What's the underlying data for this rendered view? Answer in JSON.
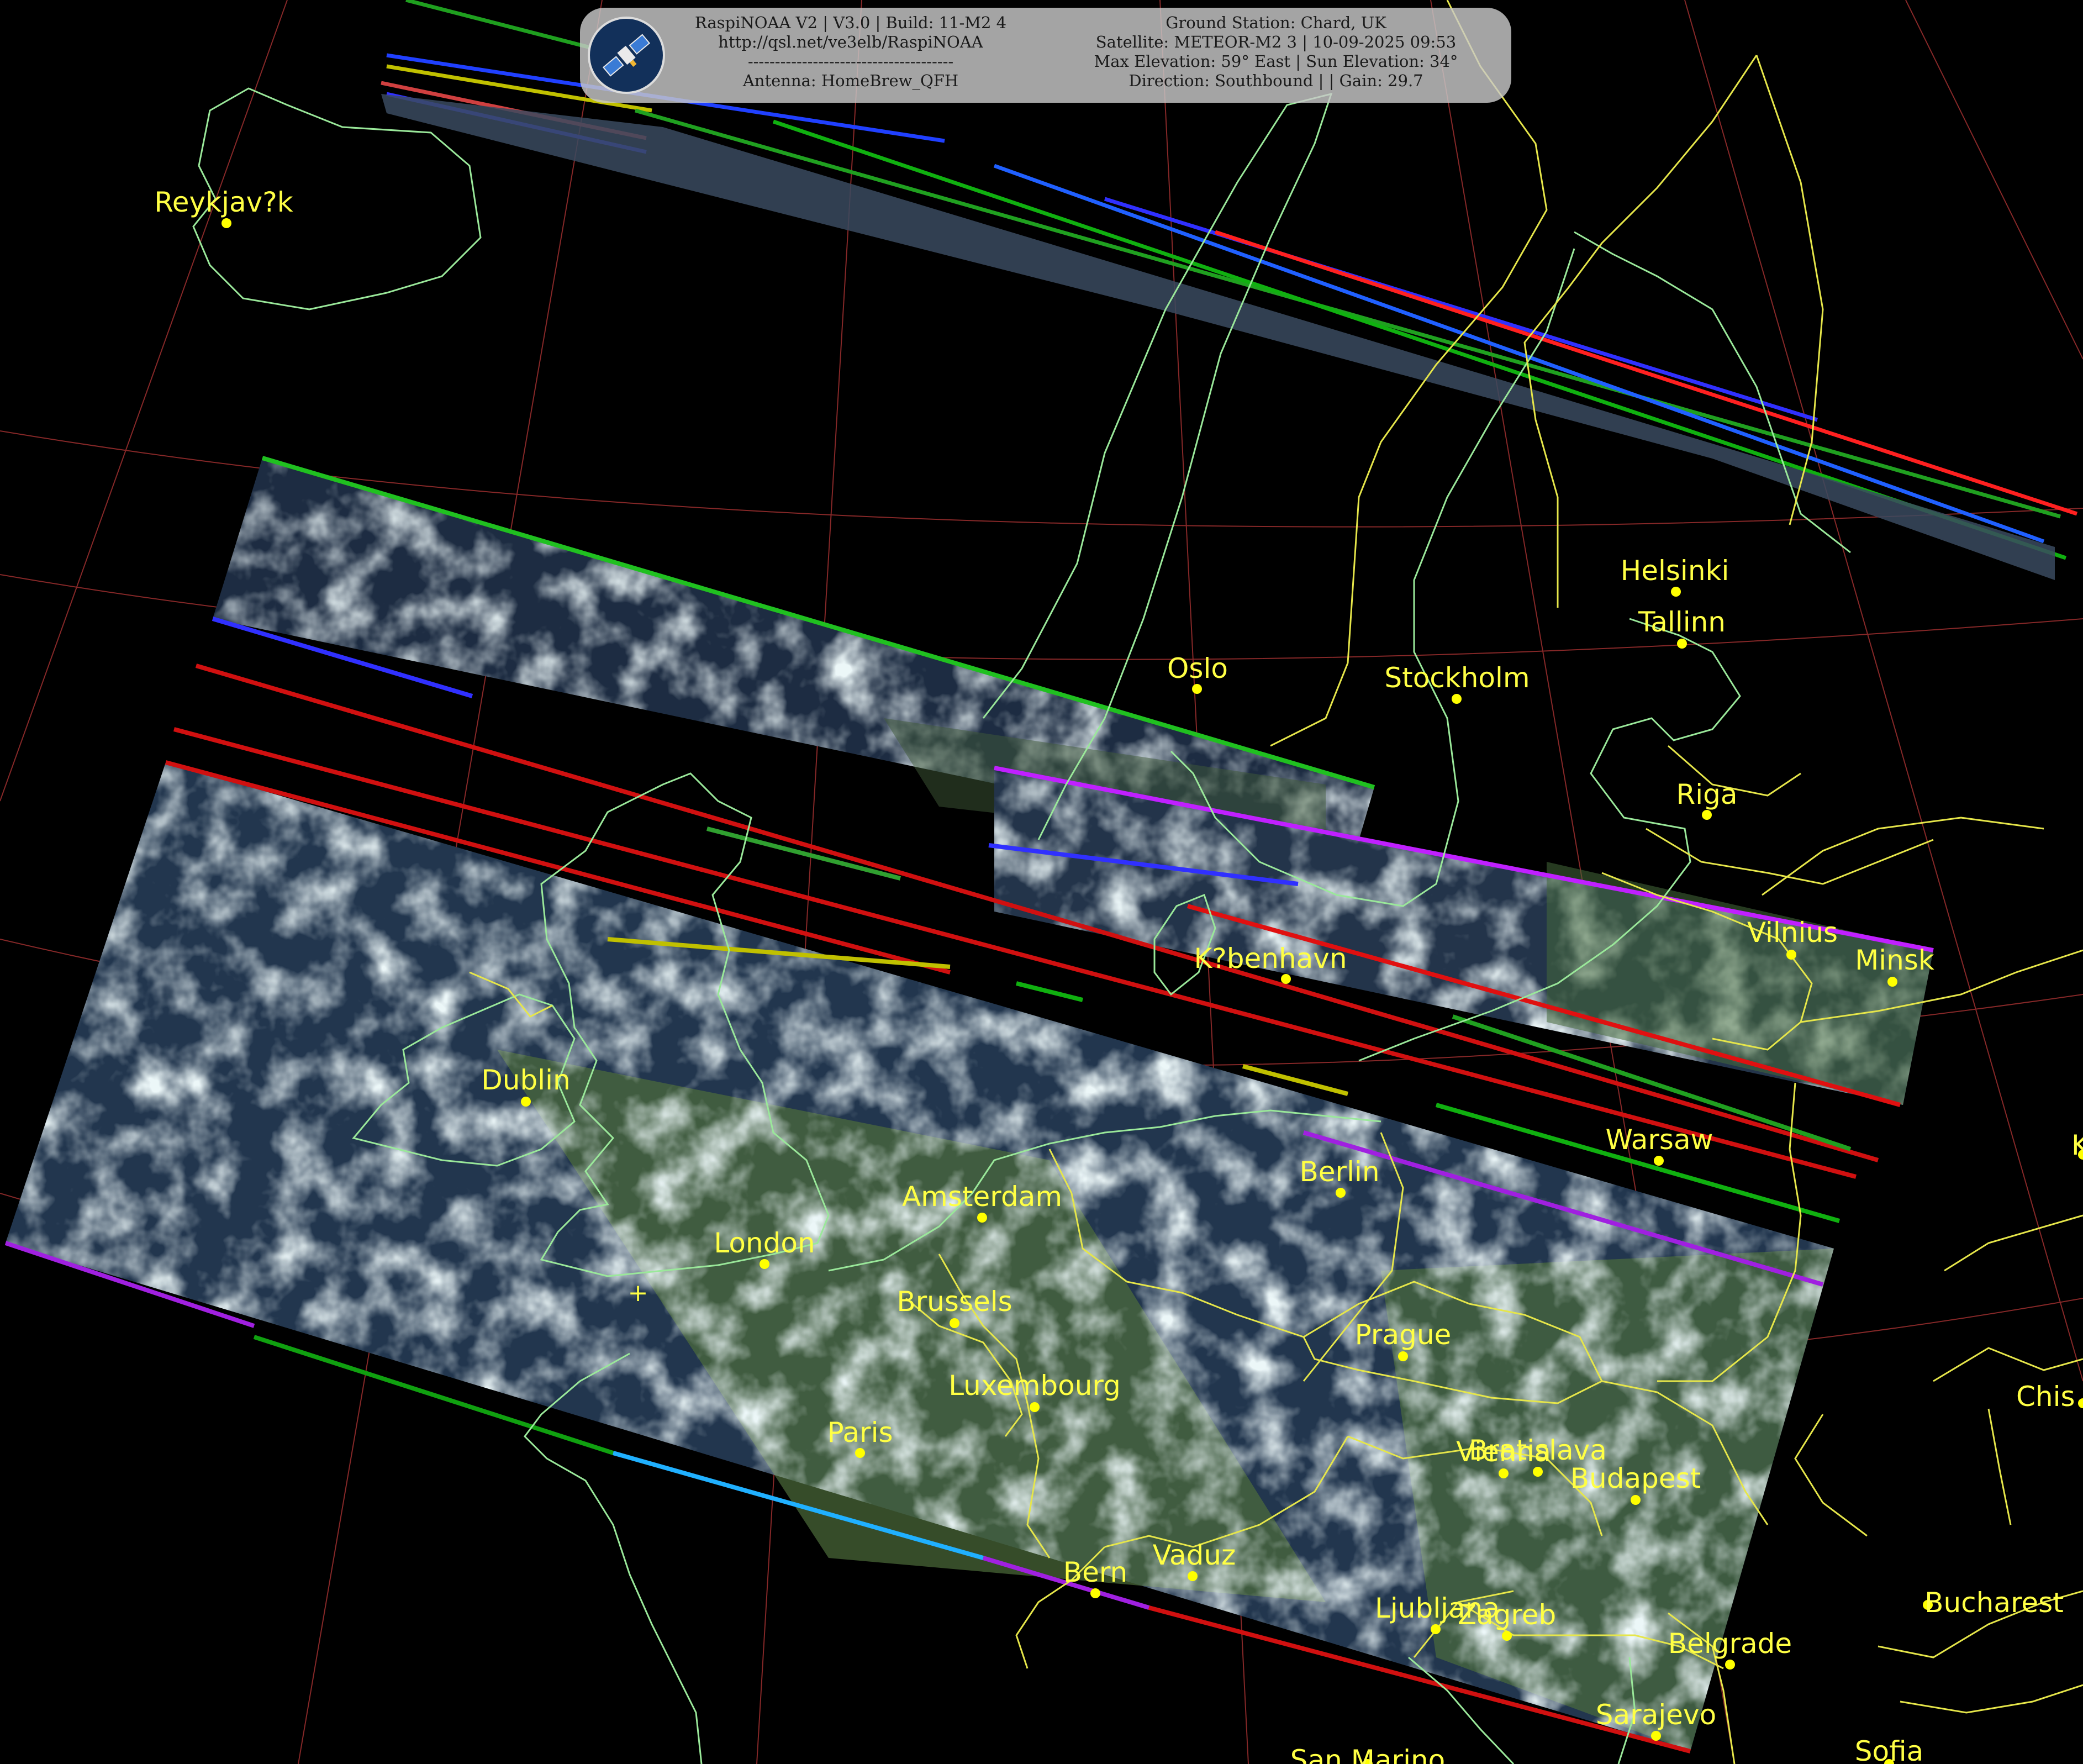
{
  "header": {
    "left_lines": [
      "RaspiNOAA V2 | V3.0 | Build: 11-M2 4",
      "http://qsl.net/ve3elb/RaspiNOAA",
      "--------------------------------------",
      "Antenna: HomeBrew_QFH"
    ],
    "right_lines": [
      "Ground Station: Chard, UK",
      "Satellite: METEOR-M2 3 | 10-09-2025 09:53",
      "Max Elevation: 59° East | Sun Elevation: 34°",
      "Direction: Southbound | | Gain: 29.7"
    ],
    "logo_icon": "satellite-icon"
  },
  "cities": [
    {
      "name": "Reykjav?k"
    },
    {
      "name": "Helsinki"
    },
    {
      "name": "Tallinn"
    },
    {
      "name": "Oslo"
    },
    {
      "name": "Stockholm"
    },
    {
      "name": "Riga"
    },
    {
      "name": "Vilnius"
    },
    {
      "name": "Minsk"
    },
    {
      "name": "K?benhavn"
    },
    {
      "name": "Dublin"
    },
    {
      "name": "Warsaw"
    },
    {
      "name": "Ki"
    },
    {
      "name": "Berlin"
    },
    {
      "name": "Amsterdam"
    },
    {
      "name": "London"
    },
    {
      "name": "Brussels"
    },
    {
      "name": "Prague"
    },
    {
      "name": "Luxembourg"
    },
    {
      "name": "Paris"
    },
    {
      "name": "Chis"
    },
    {
      "name": "Vienna"
    },
    {
      "name": "Bratislava"
    },
    {
      "name": "Budapest"
    },
    {
      "name": "Vaduz"
    },
    {
      "name": "Bern"
    },
    {
      "name": "Bucharest"
    },
    {
      "name": "Ljubljana"
    },
    {
      "name": "Zagreb"
    },
    {
      "name": "Belgrade"
    },
    {
      "name": "Sarajevo"
    },
    {
      "name": "Sofia"
    },
    {
      "name": "San Marino"
    }
  ],
  "ground_station_marker": "+",
  "colors": {
    "city": "#ffff44",
    "coastline": "#9ae89a",
    "border": "#e6e64a",
    "grid": "#a83232",
    "cloud": "#d6eef0",
    "ocean": "#1b2a3e",
    "land": "#4a6a3c"
  }
}
